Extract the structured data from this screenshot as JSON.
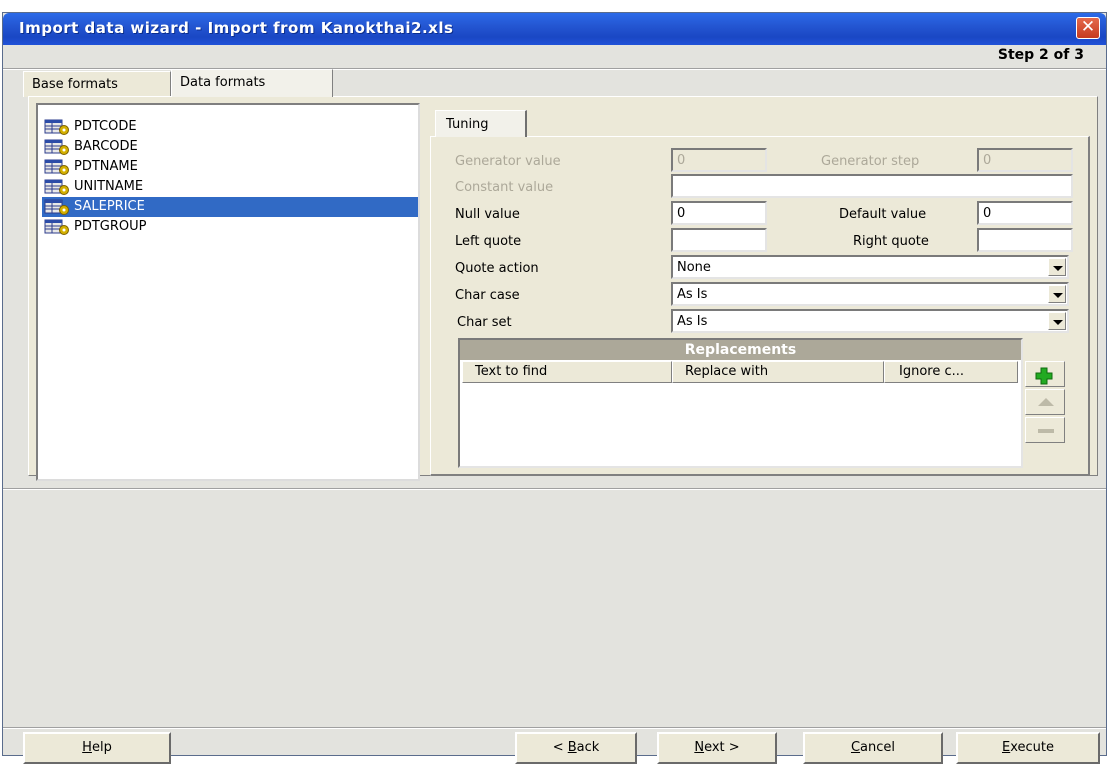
{
  "window": {
    "title": "Import data wizard - Import from Kanokthai2.xls",
    "close_glyph": "✕",
    "step": "Step 2 of 3"
  },
  "outer_tabs": [
    {
      "label": "Base formats"
    },
    {
      "label": "Data formats"
    }
  ],
  "fields": [
    {
      "name": "PDTCODE"
    },
    {
      "name": "BARCODE"
    },
    {
      "name": "PDTNAME"
    },
    {
      "name": "UNITNAME"
    },
    {
      "name": "SALEPRICE",
      "selected": true
    },
    {
      "name": "PDTGROUP"
    }
  ],
  "tuning": {
    "tab_label": "Tuning",
    "generator_value_label": "Generator value",
    "generator_value": "0",
    "generator_step_label": "Generator step",
    "generator_step": "0",
    "constant_value_label": "Constant value",
    "constant_value": "",
    "null_value_label": "Null value",
    "null_value": "0",
    "default_value_label": "Default value",
    "default_value": "0",
    "left_quote_label": "Left quote",
    "left_quote": "",
    "right_quote_label": "Right quote",
    "right_quote": "",
    "quote_action_label": "Quote action",
    "quote_action": "None",
    "char_case_label": "Char case",
    "char_case": "As Is",
    "char_set_label": "Char set",
    "char_set": "As Is"
  },
  "replacements": {
    "title": "Replacements",
    "columns": [
      "Text to find",
      "Replace with",
      "Ignore c..."
    ],
    "rows": []
  },
  "buttons": {
    "help": {
      "pre": "",
      "u": "H",
      "post": "elp"
    },
    "back": {
      "pre": "< ",
      "u": "B",
      "post": "ack"
    },
    "next": {
      "pre": "",
      "u": "N",
      "post": "ext >"
    },
    "cancel": {
      "pre": "",
      "u": "C",
      "post": "ancel"
    },
    "execute": {
      "pre": "",
      "u": "E",
      "post": "xecute"
    }
  },
  "colors": {
    "title_bar": "#2456d2",
    "selection": "#316ac5",
    "add_icon": "#22aa22"
  },
  "icons": {
    "close": "close-icon",
    "field": "table-field-icon",
    "add": "plus-icon",
    "move_up": "triangle-up-icon",
    "remove": "minus-icon",
    "dropdown": "chevron-down-icon"
  }
}
